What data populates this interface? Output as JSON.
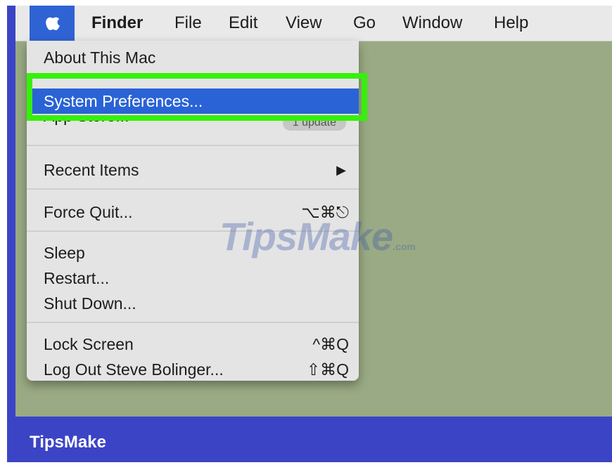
{
  "menubar": {
    "apple_icon": "apple-logo-icon",
    "items": [
      "Finder",
      "File",
      "Edit",
      "View",
      "Go",
      "Window",
      "Help"
    ]
  },
  "apple_menu": {
    "items": [
      {
        "label": "About This Mac"
      },
      {
        "label": "System Preferences...",
        "highlighted": true
      },
      {
        "label": "App Store...",
        "badge": "1 update"
      },
      {
        "label": "Recent Items",
        "submenu_icon": "right-arrow-icon",
        "shortcut": "▶"
      },
      {
        "label": "Force Quit...",
        "shortcut": "⌥⌘⎋"
      },
      {
        "label": "Sleep"
      },
      {
        "label": "Restart..."
      },
      {
        "label": "Shut Down..."
      },
      {
        "label": "Lock Screen",
        "shortcut": "^⌘Q"
      },
      {
        "label": "Log Out Steve Bolinger...",
        "shortcut": "⇧⌘Q"
      }
    ]
  },
  "watermark": {
    "brand": "TipsMake",
    "suffix": ".com"
  },
  "footer": {
    "brand": "TipsMake"
  },
  "colors": {
    "highlight_outline": "#36f00c",
    "selection": "#2a63d6",
    "footer": "#3c44c6",
    "desktop": "#9aaa84"
  }
}
